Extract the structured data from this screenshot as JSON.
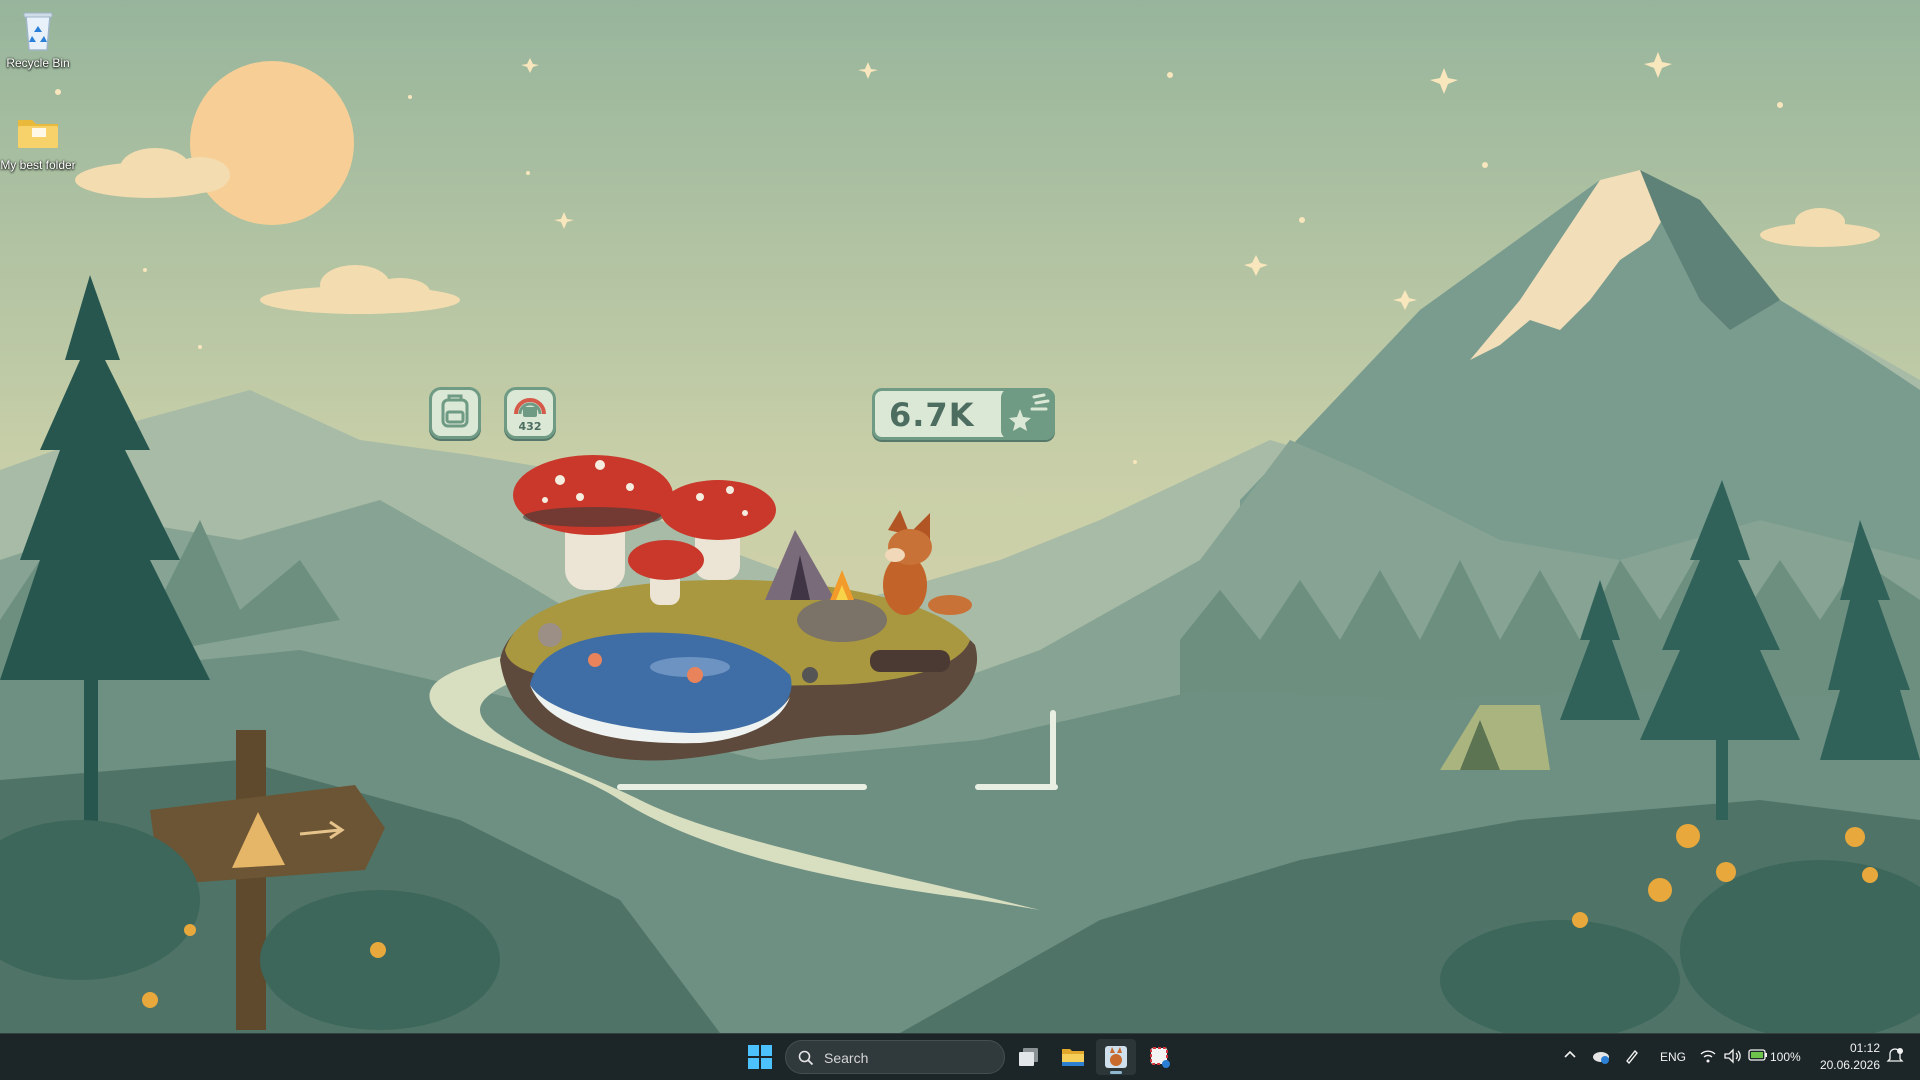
{
  "desktop": {
    "icons": [
      {
        "id": "recycle-bin",
        "label": "Recycle Bin"
      },
      {
        "id": "folder",
        "label": "My best folder"
      }
    ]
  },
  "widget": {
    "backpack_icon": "backpack-icon",
    "collection_badge": "432",
    "collection_icon": "rainbow-chest-icon",
    "currency_value": "6.7K",
    "currency_icon": "shooting-star-icon",
    "colors": {
      "panel": "#dbe8d6",
      "border": "#6f9a84",
      "text": "#4d6d60"
    }
  },
  "taskbar": {
    "search_placeholder": "Search",
    "apps": [
      "start-icon",
      "task-view-icon",
      "file-explorer-icon",
      "game-app-icon",
      "snipping-tool-icon"
    ],
    "tray": {
      "language": "ENG",
      "battery": "100%",
      "time": "01:12",
      "date": "20.06.2026"
    }
  }
}
